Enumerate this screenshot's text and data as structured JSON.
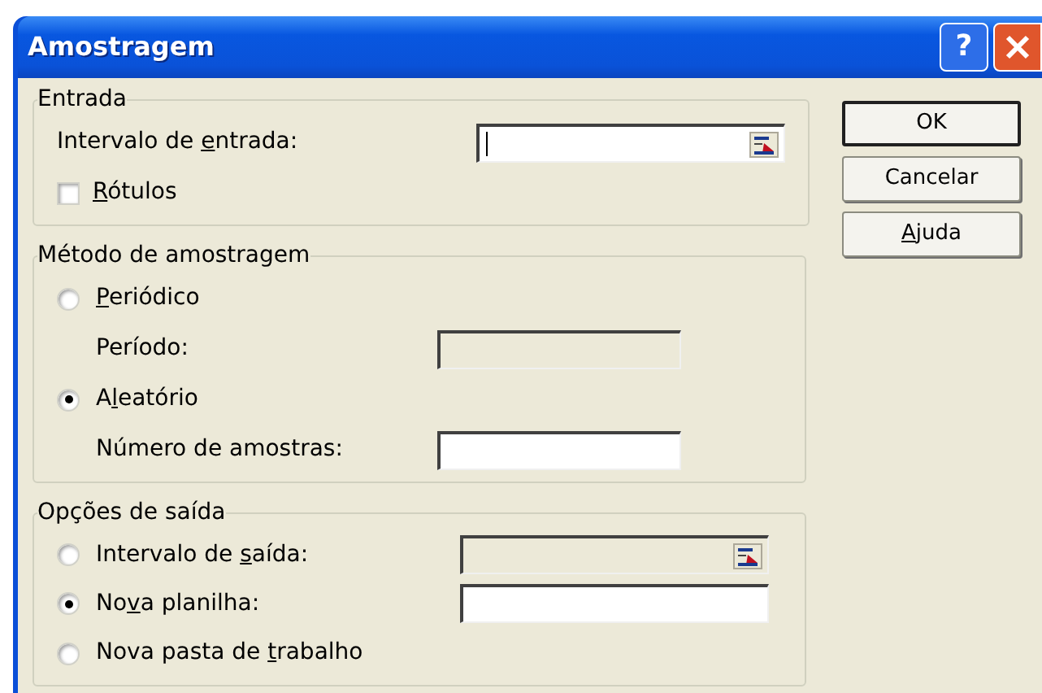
{
  "window": {
    "title": "Amostragem",
    "help_button": "?"
  },
  "groups": [
    {
      "legend": "Entrada",
      "items": [
        {
          "kind": "field",
          "label": {
            "before": "Intervalo de ",
            "key": "e",
            "after": "ntrada:"
          },
          "disabled": false,
          "picker": true,
          "focused": true,
          "wide": true
        },
        {
          "kind": "checkbox",
          "label": {
            "key": "R",
            "after": "ótulos"
          },
          "checked": false
        }
      ]
    },
    {
      "legend": "Método de amostragem",
      "items": [
        {
          "kind": "radio",
          "label": {
            "key": "P",
            "after": "eriódico"
          },
          "selected": false
        },
        {
          "kind": "field",
          "label": {
            "before": "Período:"
          },
          "disabled": true,
          "picker": false,
          "focused": false,
          "wide": false
        },
        {
          "kind": "radio",
          "label": {
            "before": "A",
            "key": "l",
            "after": "eatório"
          },
          "selected": true
        },
        {
          "kind": "field",
          "label": {
            "before": "Número de amostras:"
          },
          "disabled": false,
          "picker": false,
          "focused": false,
          "wide": false
        }
      ]
    },
    {
      "legend": "Opções de saída",
      "items": [
        {
          "kind": "radio_field",
          "label": {
            "before": "Intervalo de ",
            "key": "s",
            "after": "aída:"
          },
          "selected": false,
          "disabled": true,
          "picker": true
        },
        {
          "kind": "radio_field",
          "label": {
            "before": "No",
            "key": "v",
            "after": "a planilha:"
          },
          "selected": true,
          "disabled": false,
          "picker": false
        },
        {
          "kind": "radio",
          "label": {
            "before": "Nova pasta de ",
            "key": "t",
            "after": "rabalho"
          },
          "selected": false
        }
      ]
    }
  ],
  "buttons": [
    {
      "label": {
        "before": "OK"
      },
      "default": true
    },
    {
      "label": {
        "before": "Cancelar"
      },
      "default": false
    },
    {
      "label": {
        "key": "A",
        "after": "juda"
      },
      "default": false
    }
  ]
}
